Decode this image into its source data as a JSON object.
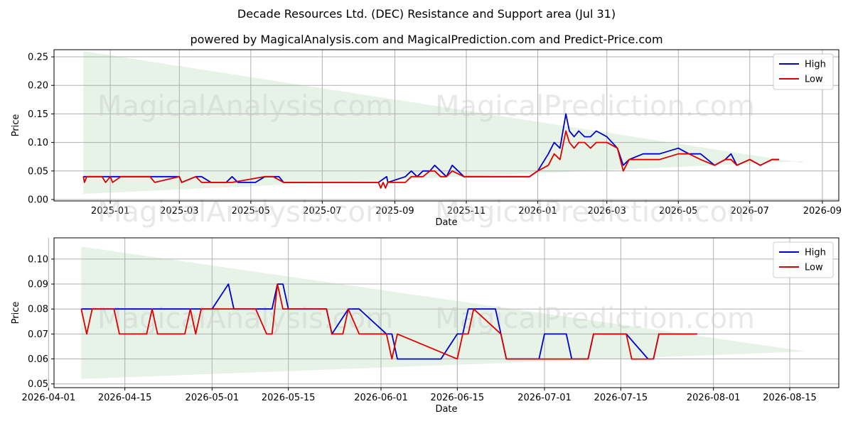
{
  "title": "Decade Resources Ltd. (DEC) Resistance and Support area (Jul 31)",
  "subtitle": "powered by MagicalAnalysis.com and MagicalPrediction.com and Predict-Price.com",
  "watermarks": [
    "MagicalAnalysis.com",
    "MagicalPrediction.com"
  ],
  "colors": {
    "high": "#0000cc",
    "low": "#dd0000",
    "band": "#dbeedb",
    "grid": "#b0b0b0"
  },
  "chart_data": [
    {
      "type": "line",
      "xlabel": "Date",
      "ylabel": "Price",
      "x_range": [
        "2024-11-14",
        "2026-09-15"
      ],
      "ylim": [
        -0.0025,
        0.2625
      ],
      "x_ticks": [
        "2025-01",
        "2025-03",
        "2025-05",
        "2025-07",
        "2025-09",
        "2025-11",
        "2026-01",
        "2026-03",
        "2026-05",
        "2026-07",
        "2026-09"
      ],
      "x_tick_dates": [
        "2025-01-01",
        "2025-03-01",
        "2025-05-01",
        "2025-07-01",
        "2025-09-01",
        "2025-11-01",
        "2026-01-01",
        "2026-03-01",
        "2026-05-01",
        "2026-07-01",
        "2026-09-01"
      ],
      "y_ticks": [
        0.0,
        0.05,
        0.1,
        0.15,
        0.2,
        0.25
      ],
      "y_tick_labels": [
        "0.00",
        "0.05",
        "0.10",
        "0.15",
        "0.20",
        "0.25"
      ],
      "grid": true,
      "legend": "top-right",
      "band": {
        "x": [
          "2024-12-09",
          "2026-08-15"
        ],
        "upper": [
          0.26,
          0.064
        ],
        "lower": [
          0.01,
          0.067
        ]
      },
      "series": [
        {
          "name": "High",
          "x": [
            "2024-12-09",
            "2024-12-10",
            "2024-12-25",
            "2025-01-01",
            "2025-02-04",
            "2025-02-10",
            "2025-03-01",
            "2025-03-03",
            "2025-03-15",
            "2025-03-20",
            "2025-03-28",
            "2025-04-10",
            "2025-04-15",
            "2025-04-20",
            "2025-04-25",
            "2025-05-05",
            "2025-05-13",
            "2025-05-25",
            "2025-05-29",
            "2025-06-01",
            "2025-08-18",
            "2025-08-25",
            "2025-08-26",
            "2025-09-10",
            "2025-09-15",
            "2025-09-20",
            "2025-09-25",
            "2025-10-01",
            "2025-10-05",
            "2025-10-10",
            "2025-10-15",
            "2025-10-20",
            "2025-10-25",
            "2025-10-30",
            "2025-11-05",
            "2025-11-25",
            "2025-12-10",
            "2025-12-25",
            "2026-01-01",
            "2026-01-10",
            "2026-01-15",
            "2026-01-20",
            "2026-01-25",
            "2026-01-28",
            "2026-02-01",
            "2026-02-05",
            "2026-02-10",
            "2026-02-15",
            "2026-02-20",
            "2026-03-01",
            "2026-03-10",
            "2026-03-15",
            "2026-03-20",
            "2026-04-01",
            "2026-04-15",
            "2026-05-01",
            "2026-05-10",
            "2026-05-20",
            "2026-06-01",
            "2026-06-10",
            "2026-06-15",
            "2026-06-20",
            "2026-07-01",
            "2026-07-10",
            "2026-07-20",
            "2026-07-26"
          ],
          "y": [
            0.04,
            0.04,
            0.04,
            0.04,
            0.04,
            0.04,
            0.04,
            0.03,
            0.04,
            0.04,
            0.03,
            0.03,
            0.04,
            0.03,
            0.03,
            0.03,
            0.04,
            0.04,
            0.03,
            0.03,
            0.03,
            0.04,
            0.03,
            0.04,
            0.05,
            0.04,
            0.05,
            0.05,
            0.06,
            0.05,
            0.04,
            0.06,
            0.05,
            0.04,
            0.04,
            0.04,
            0.04,
            0.04,
            0.05,
            0.08,
            0.1,
            0.09,
            0.15,
            0.12,
            0.11,
            0.12,
            0.11,
            0.11,
            0.12,
            0.11,
            0.09,
            0.06,
            0.07,
            0.08,
            0.08,
            0.09,
            0.08,
            0.08,
            0.06,
            0.07,
            0.08,
            0.06,
            0.07,
            0.06,
            0.07,
            0.07
          ]
        },
        {
          "name": "Low",
          "x": [
            "2024-12-09",
            "2024-12-10",
            "2024-12-12",
            "2024-12-25",
            "2024-12-28",
            "2025-01-01",
            "2025-01-03",
            "2025-01-10",
            "2025-02-04",
            "2025-02-08",
            "2025-03-01",
            "2025-03-03",
            "2025-03-15",
            "2025-03-20",
            "2025-03-28",
            "2025-04-10",
            "2025-04-15",
            "2025-05-13",
            "2025-05-20",
            "2025-05-29",
            "2025-06-01",
            "2025-08-18",
            "2025-08-20",
            "2025-08-22",
            "2025-08-24",
            "2025-08-26",
            "2025-09-10",
            "2025-09-15",
            "2025-09-25",
            "2025-10-01",
            "2025-10-05",
            "2025-10-10",
            "2025-10-15",
            "2025-10-20",
            "2025-10-30",
            "2025-11-05",
            "2025-11-25",
            "2025-12-10",
            "2025-12-25",
            "2026-01-01",
            "2026-01-10",
            "2026-01-15",
            "2026-01-20",
            "2026-01-25",
            "2026-01-28",
            "2026-02-01",
            "2026-02-05",
            "2026-02-10",
            "2026-02-15",
            "2026-02-20",
            "2026-03-01",
            "2026-03-10",
            "2026-03-15",
            "2026-03-20",
            "2026-04-01",
            "2026-04-15",
            "2026-05-01",
            "2026-05-10",
            "2026-05-20",
            "2026-06-01",
            "2026-06-10",
            "2026-06-15",
            "2026-06-20",
            "2026-07-01",
            "2026-07-10",
            "2026-07-20",
            "2026-07-26"
          ],
          "y": [
            0.04,
            0.03,
            0.04,
            0.04,
            0.03,
            0.04,
            0.03,
            0.04,
            0.04,
            0.03,
            0.04,
            0.03,
            0.04,
            0.03,
            0.03,
            0.03,
            0.03,
            0.04,
            0.04,
            0.03,
            0.03,
            0.03,
            0.02,
            0.03,
            0.02,
            0.03,
            0.03,
            0.04,
            0.04,
            0.05,
            0.05,
            0.04,
            0.04,
            0.05,
            0.04,
            0.04,
            0.04,
            0.04,
            0.04,
            0.05,
            0.06,
            0.08,
            0.07,
            0.12,
            0.1,
            0.09,
            0.1,
            0.1,
            0.09,
            0.1,
            0.1,
            0.09,
            0.05,
            0.07,
            0.07,
            0.07,
            0.08,
            0.08,
            0.07,
            0.06,
            0.07,
            0.07,
            0.06,
            0.07,
            0.06,
            0.07,
            0.07
          ]
        }
      ]
    },
    {
      "type": "line",
      "xlabel": "Date",
      "ylabel": "Price",
      "x_range": [
        "2026-04-02",
        "2026-08-24"
      ],
      "ylim": [
        0.0485,
        0.1085
      ],
      "x_ticks": [
        "2026-04-01",
        "2026-04-15",
        "2026-05-01",
        "2026-05-15",
        "2026-06-01",
        "2026-06-15",
        "2026-07-01",
        "2026-07-15",
        "2026-08-01",
        "2026-08-15"
      ],
      "x_tick_dates": [
        "2026-04-01",
        "2026-04-15",
        "2026-05-01",
        "2026-05-15",
        "2026-06-01",
        "2026-06-15",
        "2026-07-01",
        "2026-07-15",
        "2026-08-01",
        "2026-08-15"
      ],
      "y_ticks": [
        0.05,
        0.06,
        0.07,
        0.08,
        0.09,
        0.1
      ],
      "y_tick_labels": [
        "0.05",
        "0.06",
        "0.07",
        "0.08",
        "0.09",
        "0.10"
      ],
      "grid": true,
      "legend": "top-right",
      "band": {
        "x": [
          "2026-04-07",
          "2026-08-18"
        ],
        "upper": [
          0.105,
          0.063
        ],
        "lower": [
          0.052,
          0.063
        ]
      },
      "series": [
        {
          "name": "High",
          "x": [
            "2026-04-07",
            "2026-05-01",
            "2026-05-04",
            "2026-05-05",
            "2026-05-06",
            "2026-05-12",
            "2026-05-13",
            "2026-05-14",
            "2026-05-15",
            "2026-05-22",
            "2026-05-23",
            "2026-05-26",
            "2026-05-28",
            "2026-06-02",
            "2026-06-03",
            "2026-06-04",
            "2026-06-12",
            "2026-06-15",
            "2026-06-16",
            "2026-06-17",
            "2026-06-22",
            "2026-06-23",
            "2026-06-24",
            "2026-06-30",
            "2026-07-01",
            "2026-07-05",
            "2026-07-06",
            "2026-07-09",
            "2026-07-10",
            "2026-07-16",
            "2026-07-20",
            "2026-07-21",
            "2026-07-22",
            "2026-07-29"
          ],
          "y": [
            0.08,
            0.08,
            0.09,
            0.08,
            0.08,
            0.08,
            0.09,
            0.09,
            0.08,
            0.08,
            0.07,
            0.08,
            0.08,
            0.07,
            0.07,
            0.06,
            0.06,
            0.07,
            0.07,
            0.08,
            0.08,
            0.07,
            0.06,
            0.06,
            0.07,
            0.07,
            0.06,
            0.06,
            0.07,
            0.07,
            0.06,
            0.06,
            0.07,
            0.07
          ]
        },
        {
          "name": "Low",
          "x": [
            "2026-04-07",
            "2026-04-08",
            "2026-04-09",
            "2026-04-13",
            "2026-04-14",
            "2026-04-19",
            "2026-04-20",
            "2026-04-21",
            "2026-04-26",
            "2026-04-27",
            "2026-04-28",
            "2026-04-29",
            "2026-05-09",
            "2026-05-11",
            "2026-05-12",
            "2026-05-13",
            "2026-05-14",
            "2026-05-22",
            "2026-05-23",
            "2026-05-25",
            "2026-05-26",
            "2026-05-28",
            "2026-06-02",
            "2026-06-03",
            "2026-06-04",
            "2026-06-15",
            "2026-06-16",
            "2026-06-17",
            "2026-06-18",
            "2026-06-23",
            "2026-06-24",
            "2026-07-09",
            "2026-07-10",
            "2026-07-16",
            "2026-07-17",
            "2026-07-20",
            "2026-07-21",
            "2026-07-22",
            "2026-07-29"
          ],
          "y": [
            0.08,
            0.07,
            0.08,
            0.08,
            0.07,
            0.07,
            0.08,
            0.07,
            0.07,
            0.08,
            0.07,
            0.08,
            0.08,
            0.07,
            0.07,
            0.09,
            0.08,
            0.08,
            0.07,
            0.07,
            0.08,
            0.07,
            0.07,
            0.06,
            0.07,
            0.06,
            0.07,
            0.07,
            0.08,
            0.07,
            0.06,
            0.06,
            0.07,
            0.07,
            0.06,
            0.06,
            0.06,
            0.07,
            0.07
          ]
        }
      ]
    }
  ]
}
